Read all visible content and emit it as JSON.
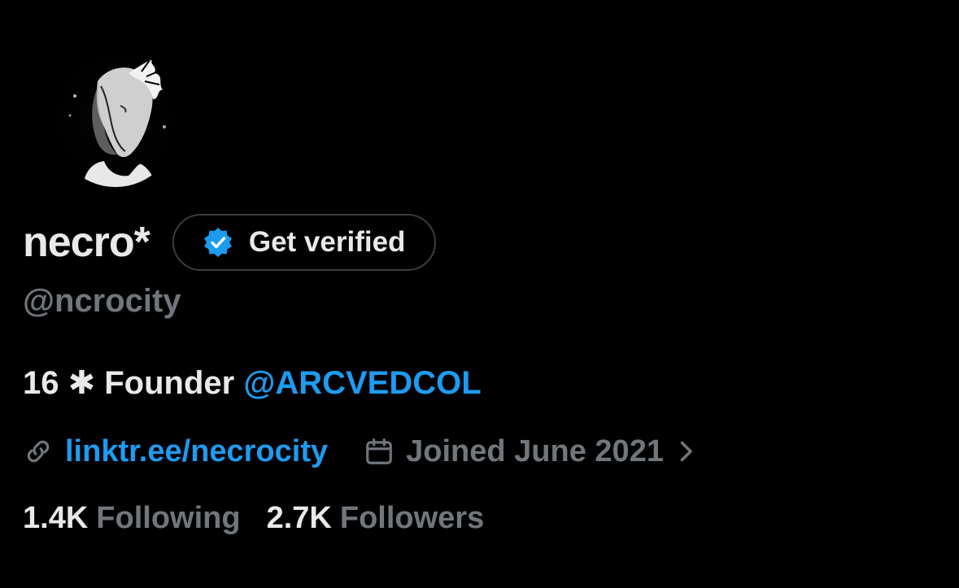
{
  "profile": {
    "display_name": "necro*",
    "handle": "@ncrocity",
    "verify_button_label": "Get verified",
    "bio_text": "16 ✱ Founder ",
    "bio_mention": "@ARCVEDCOL",
    "link": "linktr.ee/necrocity",
    "joined": "Joined June 2021",
    "following_count": "1.4K",
    "following_label": "Following",
    "followers_count": "2.7K",
    "followers_label": "Followers"
  },
  "icons": {
    "avatar": "avatar-image",
    "badge": "verified-badge-icon",
    "link": "link-icon",
    "calendar": "calendar-icon",
    "chevron": "chevron-right-icon"
  },
  "colors": {
    "background": "#000000",
    "text_primary": "#e7e9ea",
    "text_secondary": "#71767b",
    "accent": "#1d9bf0",
    "button_border": "#3a3d40"
  }
}
